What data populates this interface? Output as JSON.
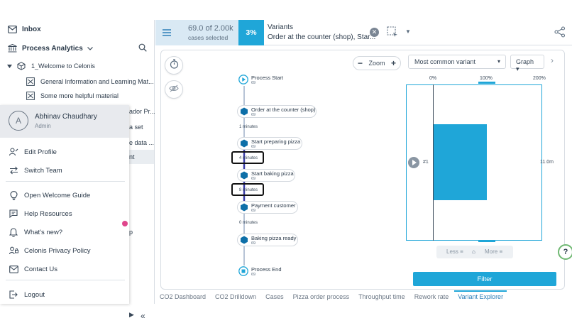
{
  "sidebar": {
    "inbox_label": "Inbox",
    "section_label": "Process Analytics",
    "tree": {
      "root": "1_Welcome to Celonis",
      "item1": "General Information and Learning Mat...",
      "item2": "Some more helpful material"
    },
    "partial_labels": [
      "ador Pr...",
      "a set",
      "e data ...",
      "nt",
      "p"
    ]
  },
  "user_menu": {
    "avatar_initial": "A",
    "name": "Abhinav Chaudhary",
    "role": "Admin",
    "items": [
      {
        "label": "Edit Profile",
        "icon": "edit-profile-icon"
      },
      {
        "label": "Switch Team",
        "icon": "switch-icon"
      },
      {
        "label": "Open Welcome Guide",
        "icon": "lightbulb-icon"
      },
      {
        "label": "Help Resources",
        "icon": "help-doc-icon"
      },
      {
        "label": "What's new?",
        "icon": "bell-icon"
      },
      {
        "label": "Celonis Privacy Policy",
        "icon": "privacy-icon"
      },
      {
        "label": "Contact Us",
        "icon": "mail-icon"
      },
      {
        "label": "Logout",
        "icon": "logout-icon"
      }
    ],
    "collapse_glyph": "«"
  },
  "header": {
    "cases_count": "69.0 of 2.00k",
    "cases_label": "cases selected",
    "percent": "3%",
    "variants_title": "Variants",
    "variants_value": "Order at the counter (shop), Star..."
  },
  "canvas": {
    "zoom_label": "Zoom",
    "nodes": [
      {
        "label": "Process Start",
        "count": "69",
        "kind": "start"
      },
      {
        "label": "Order at the counter (shop)",
        "count": "69",
        "kind": "activity"
      },
      {
        "label": "Start preparing pizza",
        "count": "69",
        "kind": "activity"
      },
      {
        "label": "Start baking pizza",
        "count": "69",
        "kind": "activity"
      },
      {
        "label": "Payment customer",
        "count": "69",
        "kind": "activity"
      },
      {
        "label": "Baking pizza ready",
        "count": "69",
        "kind": "activity"
      },
      {
        "label": "Process End",
        "count": "69",
        "kind": "end"
      }
    ],
    "edge_labels": [
      "1 minutes",
      "4 minutes",
      "8 minutes",
      "0 minutes"
    ]
  },
  "variant_panel": {
    "sort_option": "Most common variant",
    "view_option": "Graph",
    "ticks": [
      "0%",
      "100%",
      "200%"
    ],
    "rank": "#1",
    "duration": "11.0m",
    "less_label": "Less",
    "more_label": "More",
    "filter_label": "Filter"
  },
  "chart_data": {
    "type": "bar",
    "categories": [
      "#1"
    ],
    "values": [
      100
    ],
    "xlim": [
      0,
      200
    ],
    "tick_labels": [
      "0%",
      "100%",
      "200%"
    ]
  },
  "tabs": [
    {
      "label": "CO2 Dashboard",
      "active": false
    },
    {
      "label": "CO2 Drilldown",
      "active": false
    },
    {
      "label": "Cases",
      "active": false
    },
    {
      "label": "Pizza order process",
      "active": false
    },
    {
      "label": "Throughput time",
      "active": false
    },
    {
      "label": "Rework rate",
      "active": false
    },
    {
      "label": "Variant Explorer",
      "active": true
    }
  ],
  "colors": {
    "accent": "#1fa6d8",
    "header_bg": "#d9e9f4",
    "node_hex": "#0d6fa8",
    "edge": "#b7c4d6",
    "edge_highlight": "#3b3ea8"
  }
}
